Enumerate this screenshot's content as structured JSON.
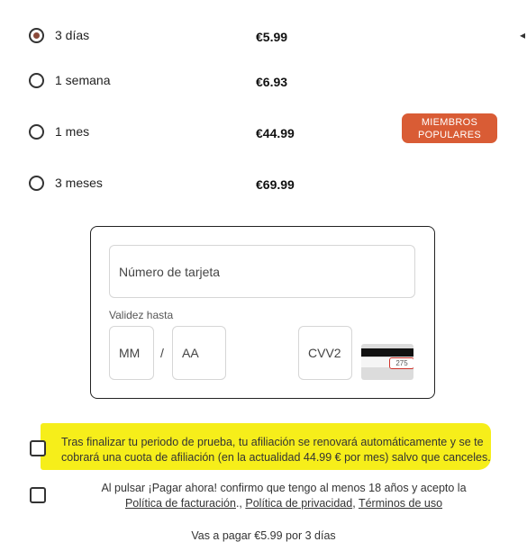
{
  "plans": [
    {
      "label": "3 días",
      "price": "€5.99",
      "selected": true
    },
    {
      "label": "1 semana",
      "price": "€6.93",
      "selected": false
    },
    {
      "label": "1 mes",
      "price": "€44.99",
      "selected": false,
      "badge_line1": "MIEMBROS",
      "badge_line2": "POPULARES"
    },
    {
      "label": "3 meses",
      "price": "€69.99",
      "selected": false
    }
  ],
  "edge_mark": "◂",
  "card_form": {
    "card_number_placeholder": "Número de tarjeta",
    "validity_label": "Validez hasta",
    "month_placeholder": "MM",
    "separator": "/",
    "year_placeholder": "AA",
    "cvv_placeholder": "CVV2",
    "cvv_sample": "275"
  },
  "terms": {
    "renewal_highlighted": "Tras finalizar tu periodo de prueba, tu afiliación se renovará automáticamente y se te cobrará una cuota de afiliación (en la actualidad 44.99 € por mes)",
    "renewal_rest": " salvo que canceles.",
    "consent_text": "Al pulsar ¡Pagar ahora! confirmo que tengo al menos 18 años y acepto la",
    "billing_policy": "Política de facturación",
    "sep1": "., ",
    "privacy_policy": "Política de privacidad",
    "sep2": ", ",
    "terms_of_use": "Términos de uso"
  },
  "pay_summary": "Vas a pagar €5.99 por 3 días",
  "colors": {
    "accent": "#d95c35",
    "highlight": "#f6ee1a",
    "radio_fill": "#8a4a3a"
  }
}
